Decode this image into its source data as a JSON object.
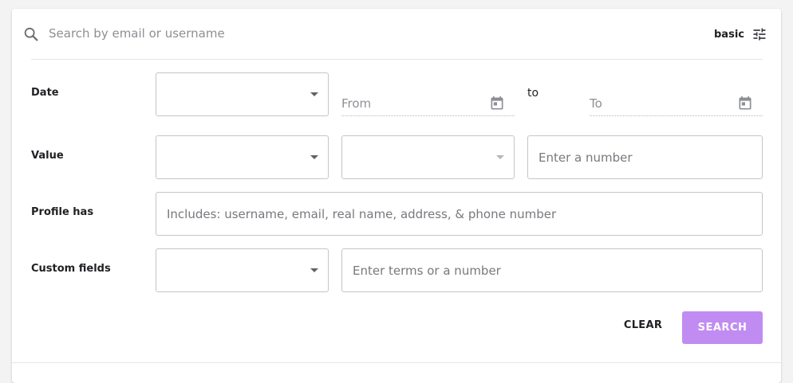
{
  "search": {
    "placeholder": "Search by email or username",
    "value": "",
    "icon": "search-icon"
  },
  "mode": {
    "label": "basic",
    "icon": "tune-icon"
  },
  "filters": {
    "date": {
      "label": "Date",
      "operator": {
        "value": ""
      },
      "from": {
        "placeholder": "From",
        "value": "",
        "icon": "calendar-icon"
      },
      "to_label": "to",
      "to": {
        "placeholder": "To",
        "value": "",
        "icon": "calendar-icon"
      }
    },
    "value": {
      "label": "Value",
      "field_select": {
        "value": ""
      },
      "operator_select": {
        "value": "",
        "disabled": true
      },
      "number": {
        "placeholder": "Enter a number",
        "value": ""
      }
    },
    "profile_has": {
      "label": "Profile has",
      "input": {
        "placeholder": "Includes: username, email, real name, address, & phone number",
        "value": ""
      }
    },
    "custom_fields": {
      "label": "Custom fields",
      "field_select": {
        "value": ""
      },
      "terms": {
        "placeholder": "Enter terms or a number",
        "value": ""
      }
    }
  },
  "actions": {
    "clear_label": "CLEAR",
    "search_label": "SEARCH"
  },
  "colors": {
    "accent": "#c18cf2",
    "text": "#202124",
    "border": "#c4c5c8",
    "placeholder": "#8d8f94"
  }
}
